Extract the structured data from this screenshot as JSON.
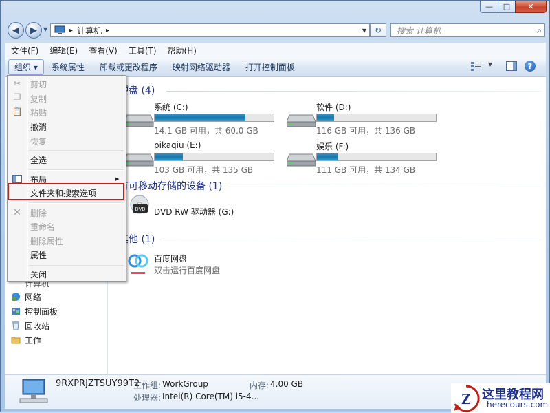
{
  "window": {
    "caption_buttons": {
      "minimize": "—",
      "maximize": "□",
      "close": "✕"
    }
  },
  "nav": {
    "back": "◀",
    "forward": "▶",
    "address": {
      "breadcrumb": [
        "计算机"
      ],
      "arrow": "▸"
    },
    "refresh": "↻",
    "search_placeholder": "搜索 计算机"
  },
  "menubar": [
    "文件(F)",
    "编辑(E)",
    "查看(V)",
    "工具(T)",
    "帮助(H)"
  ],
  "cmdbar": {
    "organize": "组织 ▾",
    "items": [
      "系统属性",
      "卸载或更改程序",
      "映射网络驱动器",
      "打开控制面板"
    ],
    "help": "?"
  },
  "groups": {
    "hard_disks": "硬盘 (4)",
    "removable": "有可移动存储的设备 (1)",
    "other": "其他 (1)"
  },
  "drives": [
    {
      "name": "系统 (C:)",
      "size": "14.1 GB 可用，共 60.0 GB",
      "used_fraction": 0.765
    },
    {
      "name": "软件 (D:)",
      "size": "116 GB 可用，共 136 GB",
      "used_fraction": 0.147
    },
    {
      "name": "pikaqiu (E:)",
      "size": "103 GB 可用，共 135 GB",
      "used_fraction": 0.237
    },
    {
      "name": "娱乐 (F:)",
      "size": "111 GB 可用，共 134 GB",
      "used_fraction": 0.172
    }
  ],
  "dvd": {
    "name": "DVD RW 驱动器 (G:)",
    "icon_label": "DVD"
  },
  "other": {
    "name": "百度网盘",
    "desc": "双击运行百度网盘"
  },
  "nav_pane": {
    "computer_partial": "计算机",
    "items": [
      "网络",
      "控制面板",
      "回收站",
      "工作"
    ]
  },
  "details": {
    "computer_name": "9RXPRJZTSUY99T2",
    "workgroup_label": "工作组:",
    "workgroup": "WorkGroup",
    "memory_label": "内存:",
    "memory": "4.00 GB",
    "processor_label": "处理器:",
    "processor": "Intel(R) Core(TM) i5-4..."
  },
  "context_menu": {
    "cut": "剪切",
    "copy": "复制",
    "paste": "粘贴",
    "undo": "撤消",
    "redo": "恢复",
    "select_all": "全选",
    "layout": "布局",
    "folder_options": "文件夹和搜索选项",
    "delete": "删除",
    "rename": "重命名",
    "remove_props": "删除属性",
    "properties": "属性",
    "close": "关闭"
  },
  "watermark": {
    "text": "这里教程网",
    "url": "herecours.com"
  },
  "colors": {
    "accent": "#1e3287",
    "highlight_border": "#c0211a",
    "drive_fill": "#1d74a8"
  }
}
